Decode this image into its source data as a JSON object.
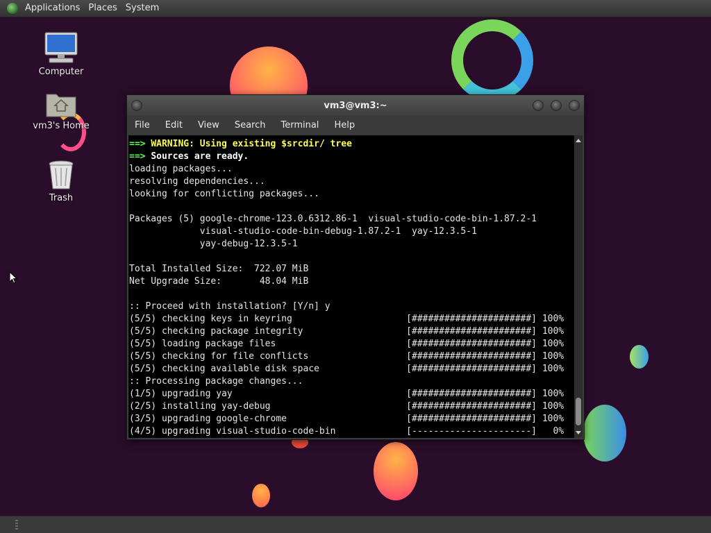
{
  "top_panel": {
    "menus": [
      "Applications",
      "Places",
      "System"
    ]
  },
  "desktop": {
    "icons": [
      {
        "label": "Computer",
        "icon": "computer-icon"
      },
      {
        "label": "vm3's Home",
        "icon": "home-folder-icon"
      },
      {
        "label": "Trash",
        "icon": "trash-icon"
      }
    ]
  },
  "window": {
    "title": "vm3@vm3:~",
    "menus": [
      "File",
      "Edit",
      "View",
      "Search",
      "Terminal",
      "Help"
    ]
  },
  "terminal": {
    "lines": [
      {
        "type": "warn",
        "arrow": "==>",
        "text": "WARNING: Using existing $srcdir/ tree"
      },
      {
        "type": "info",
        "arrow": "==>",
        "text": "Sources are ready."
      },
      {
        "type": "plain",
        "text": "loading packages..."
      },
      {
        "type": "plain",
        "text": "resolving dependencies..."
      },
      {
        "type": "plain",
        "text": "looking for conflicting packages..."
      },
      {
        "type": "plain",
        "text": ""
      },
      {
        "type": "plain",
        "text": "Packages (5) google-chrome-123.0.6312.86-1  visual-studio-code-bin-1.87.2-1"
      },
      {
        "type": "plain",
        "text": "             visual-studio-code-bin-debug-1.87.2-1  yay-12.3.5-1"
      },
      {
        "type": "plain",
        "text": "             yay-debug-12.3.5-1"
      },
      {
        "type": "plain",
        "text": ""
      },
      {
        "type": "plain",
        "text": "Total Installed Size:  722.07 MiB"
      },
      {
        "type": "plain",
        "text": "Net Upgrade Size:       48.04 MiB"
      },
      {
        "type": "plain",
        "text": ""
      },
      {
        "type": "plain",
        "text": ":: Proceed with installation? [Y/n] y"
      },
      {
        "type": "plain",
        "text": "(5/5) checking keys in keyring                     [######################] 100%"
      },
      {
        "type": "plain",
        "text": "(5/5) checking package integrity                   [######################] 100%"
      },
      {
        "type": "plain",
        "text": "(5/5) loading package files                        [######################] 100%"
      },
      {
        "type": "plain",
        "text": "(5/5) checking for file conflicts                  [######################] 100%"
      },
      {
        "type": "plain",
        "text": "(5/5) checking available disk space                [######################] 100%"
      },
      {
        "type": "plain",
        "text": ":: Processing package changes..."
      },
      {
        "type": "plain",
        "text": "(1/5) upgrading yay                                [######################] 100%"
      },
      {
        "type": "plain",
        "text": "(2/5) installing yay-debug                         [######################] 100%"
      },
      {
        "type": "plain",
        "text": "(3/5) upgrading google-chrome                      [######################] 100%"
      },
      {
        "type": "plain",
        "text": "(4/5) upgrading visual-studio-code-bin             [----------------------]   0%"
      }
    ]
  },
  "colors": {
    "wallpaper": "#2a0d2a",
    "terminal_bg": "#000000",
    "terminal_fg": "#e5e5e5",
    "arrow_green": "#5aff5a",
    "warning_yellow": "#ffff55"
  }
}
